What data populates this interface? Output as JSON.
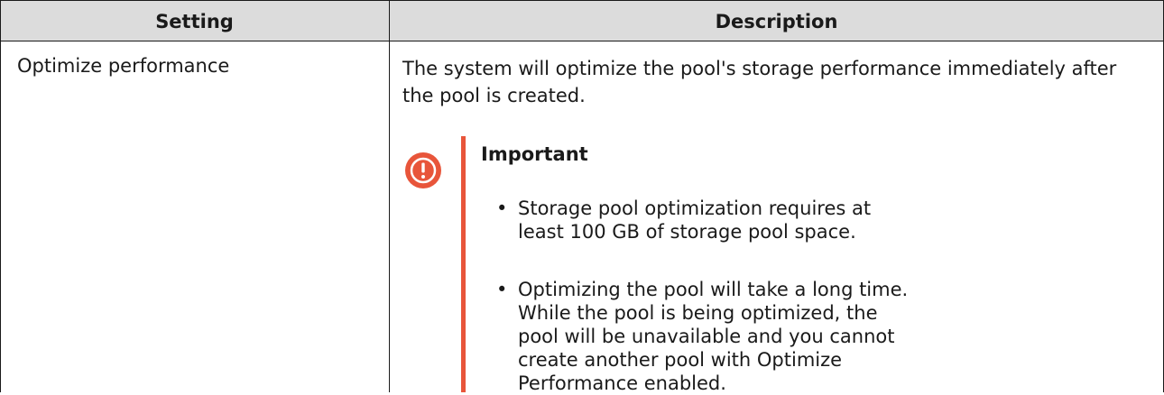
{
  "table": {
    "headers": {
      "setting": "Setting",
      "description": "Description"
    },
    "rows": [
      {
        "setting": "Optimize performance",
        "description": "The system will optimize the pool's storage performance immediately after the pool is created.",
        "note": {
          "icon": "exclamation-icon",
          "title": "Important",
          "color": "#e8553a",
          "items": [
            "Storage pool optimization requires at least 100 GB of storage pool space.",
            "Optimizing the pool will take a long time. While the pool is being optimized, the pool will be unavailable and you cannot create another pool with Optimize Performance enabled."
          ]
        }
      }
    ]
  }
}
